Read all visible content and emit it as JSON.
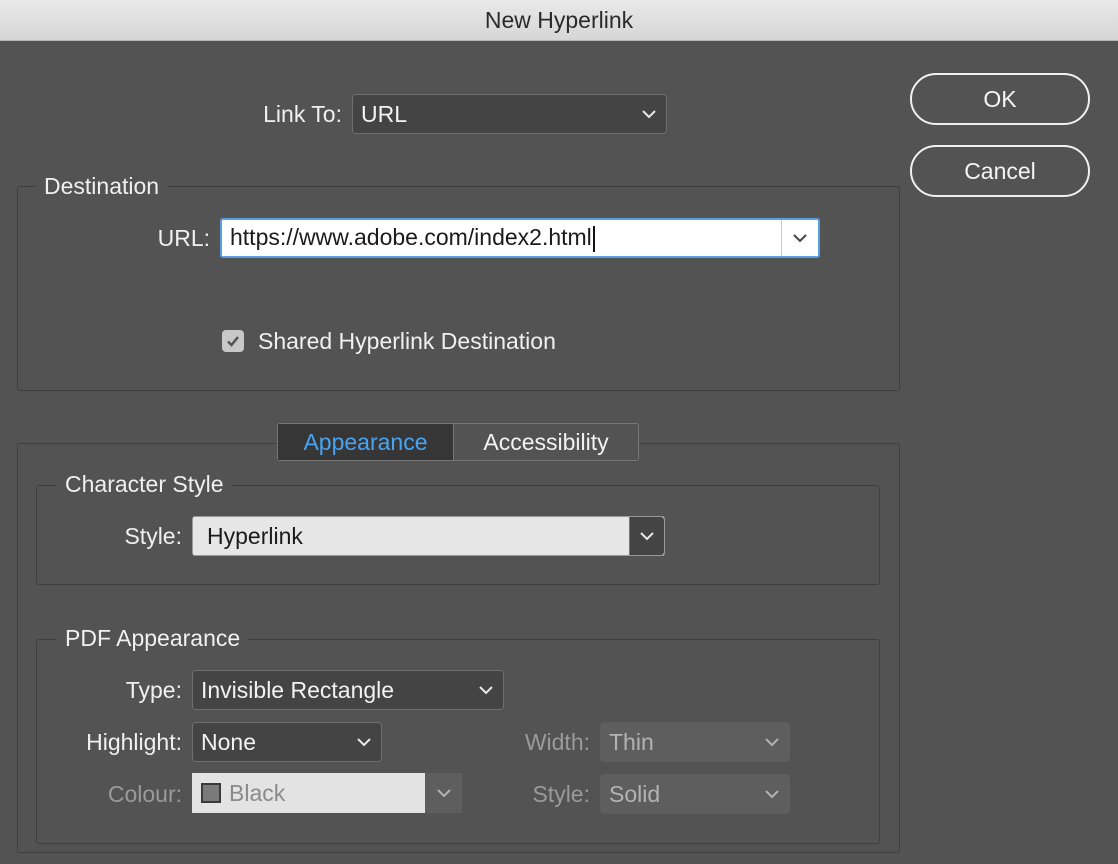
{
  "window": {
    "title": "New Hyperlink"
  },
  "buttons": {
    "ok": "OK",
    "cancel": "Cancel"
  },
  "link_to": {
    "label": "Link To:",
    "value": "URL"
  },
  "destination": {
    "title": "Destination",
    "url_label": "URL:",
    "url_value": "https://www.adobe.com/index2.html",
    "shared_label": "Shared Hyperlink Destination",
    "shared_checked": true
  },
  "tabs": [
    {
      "label": "Appearance",
      "active": true
    },
    {
      "label": "Accessibility",
      "active": false
    }
  ],
  "character_style": {
    "title": "Character Style",
    "style_label": "Style:",
    "style_value": "Hyperlink"
  },
  "pdf_appearance": {
    "title": "PDF Appearance",
    "type_label": "Type:",
    "type_value": "Invisible Rectangle",
    "highlight_label": "Highlight:",
    "highlight_value": "None",
    "width_label": "Width:",
    "width_value": "Thin",
    "colour_label": "Colour:",
    "colour_value": "Black",
    "style_label": "Style:",
    "style_value": "Solid"
  },
  "icons": [
    "chevron-down-icon",
    "checkmark-icon",
    "color-swatch-icon"
  ],
  "colors": {
    "accent": "#48a4f2",
    "focus_ring": "#5c9ee6",
    "background": "#535353"
  }
}
